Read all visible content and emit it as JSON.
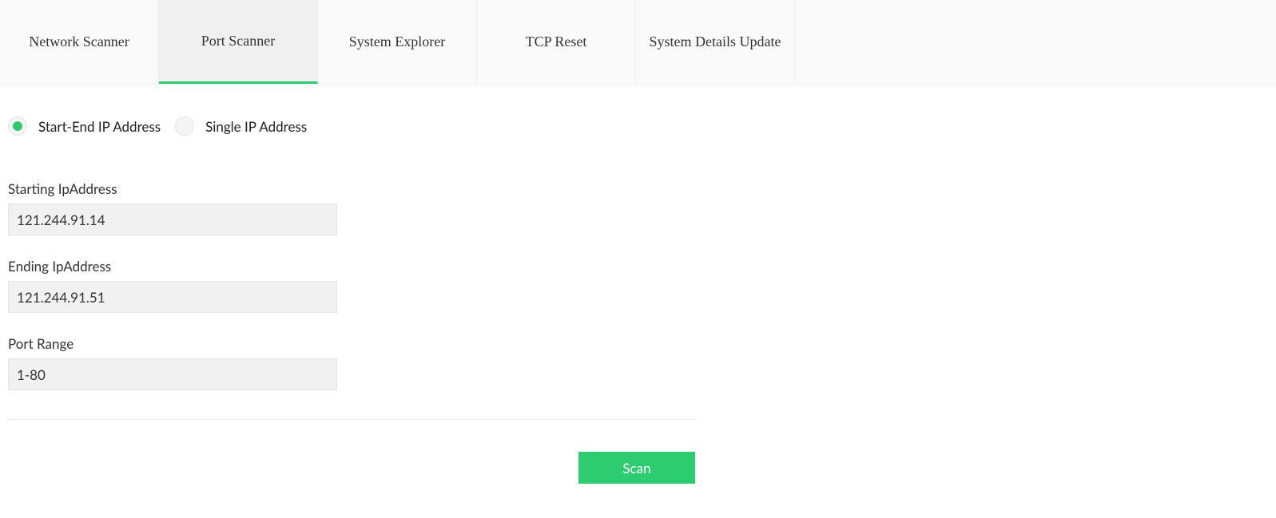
{
  "tabs": [
    {
      "label": "Network Scanner",
      "active": false
    },
    {
      "label": "Port Scanner",
      "active": true
    },
    {
      "label": "System Explorer",
      "active": false
    },
    {
      "label": "TCP Reset",
      "active": false
    },
    {
      "label": "System Details Update",
      "active": false
    }
  ],
  "mode": {
    "options": [
      {
        "label": "Start-End IP Address",
        "selected": true
      },
      {
        "label": "Single IP Address",
        "selected": false
      }
    ]
  },
  "fields": {
    "startingIp": {
      "label": "Starting IpAddress",
      "value": "121.244.91.14"
    },
    "endingIp": {
      "label": "Ending IpAddress",
      "value": "121.244.91.51"
    },
    "portRange": {
      "label": "Port Range",
      "value": "1-80"
    }
  },
  "actions": {
    "scan": "Scan"
  }
}
